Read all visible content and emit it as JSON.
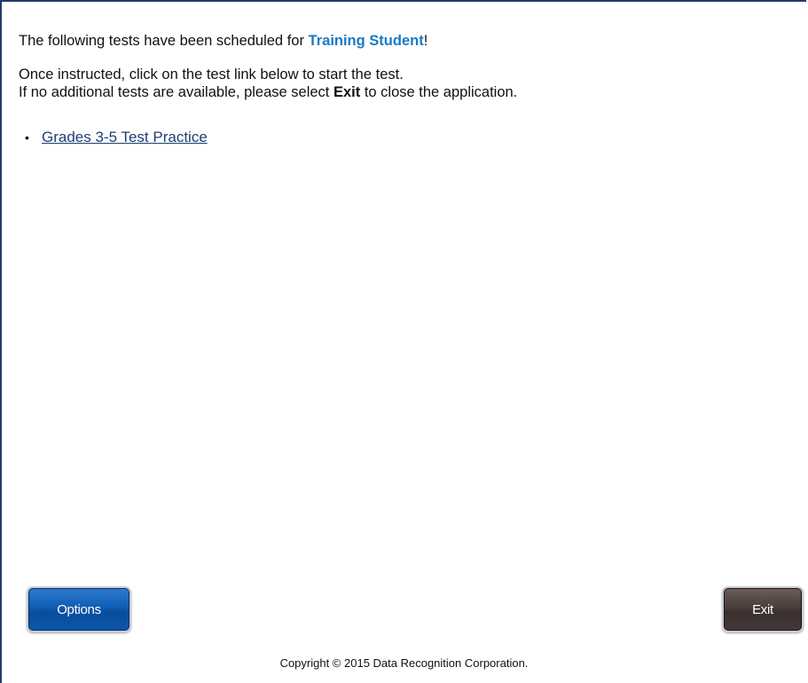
{
  "intro": {
    "prefix": "The following tests have been scheduled for ",
    "student_name": "Training Student",
    "suffix": "!"
  },
  "instructions": {
    "line1": "Once instructed, click on the test link below to start the test.",
    "line2_prefix": "If no additional tests are available, please select ",
    "line2_bold": "Exit",
    "line2_suffix": " to close the application."
  },
  "tests": [
    {
      "label": "Grades 3-5 Test Practice"
    }
  ],
  "buttons": {
    "options_label": "Options",
    "exit_label": "Exit"
  },
  "footer": {
    "copyright": "Copyright © 2015 Data Recognition Corporation."
  },
  "colors": {
    "student_name": "#1a7ac4",
    "link": "#1d3f73",
    "options_button": "#0f5db5",
    "exit_button": "#4a3e3a",
    "frame_border": "#1f3d66"
  }
}
